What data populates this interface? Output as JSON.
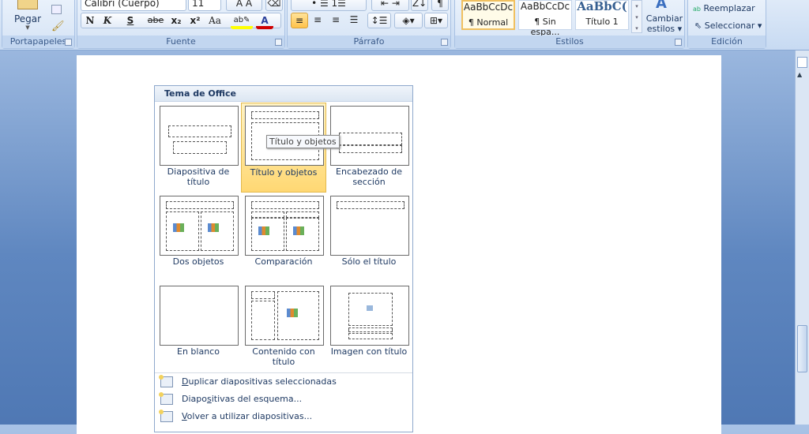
{
  "ribbon": {
    "clipboard": {
      "group_label": "Portapapeles",
      "paste_label": "Pegar"
    },
    "font": {
      "group_label": "Fuente",
      "font_name": "Calibri (Cuerpo)",
      "font_size": "11",
      "bold": "N",
      "italic": "K",
      "underline": "S",
      "strike": "abe",
      "subscript": "x₂",
      "superscript": "x²",
      "case": "Aa",
      "highlight_color": "#ffff00",
      "font_color": "#d00000"
    },
    "paragraph": {
      "group_label": "Párrafo"
    },
    "styles": {
      "group_label": "Estilos",
      "items": [
        {
          "preview": "AaBbCcDc",
          "name": "¶ Normal"
        },
        {
          "preview": "AaBbCcDc",
          "name": "¶ Sin espa..."
        },
        {
          "preview": "AaBbC(",
          "name": "Título 1"
        }
      ],
      "change_styles": "Cambiar",
      "change_styles2": "estilos"
    },
    "editing": {
      "group_label": "Edición",
      "replace": "Reemplazar",
      "select": "Seleccionar"
    }
  },
  "gallery": {
    "header": "Tema de Office",
    "layouts": [
      {
        "label": "Diapositiva de título"
      },
      {
        "label": "Título y objetos",
        "selected": true
      },
      {
        "label": "Encabezado de sección"
      },
      {
        "label": "Dos objetos"
      },
      {
        "label": "Comparación"
      },
      {
        "label": "Sólo el título"
      },
      {
        "label": "En blanco"
      },
      {
        "label": "Contenido con título"
      },
      {
        "label": "Imagen con título"
      }
    ],
    "tooltip": "Título y objetos",
    "menu": [
      {
        "key": "D",
        "rest": "uplicar diapositivas seleccionadas",
        "pre": ""
      },
      {
        "pre": "Diapo",
        "key": "s",
        "rest": "itivas del esquema..."
      },
      {
        "key": "V",
        "rest": "olver a utilizar diapositivas...",
        "pre": ""
      }
    ]
  }
}
